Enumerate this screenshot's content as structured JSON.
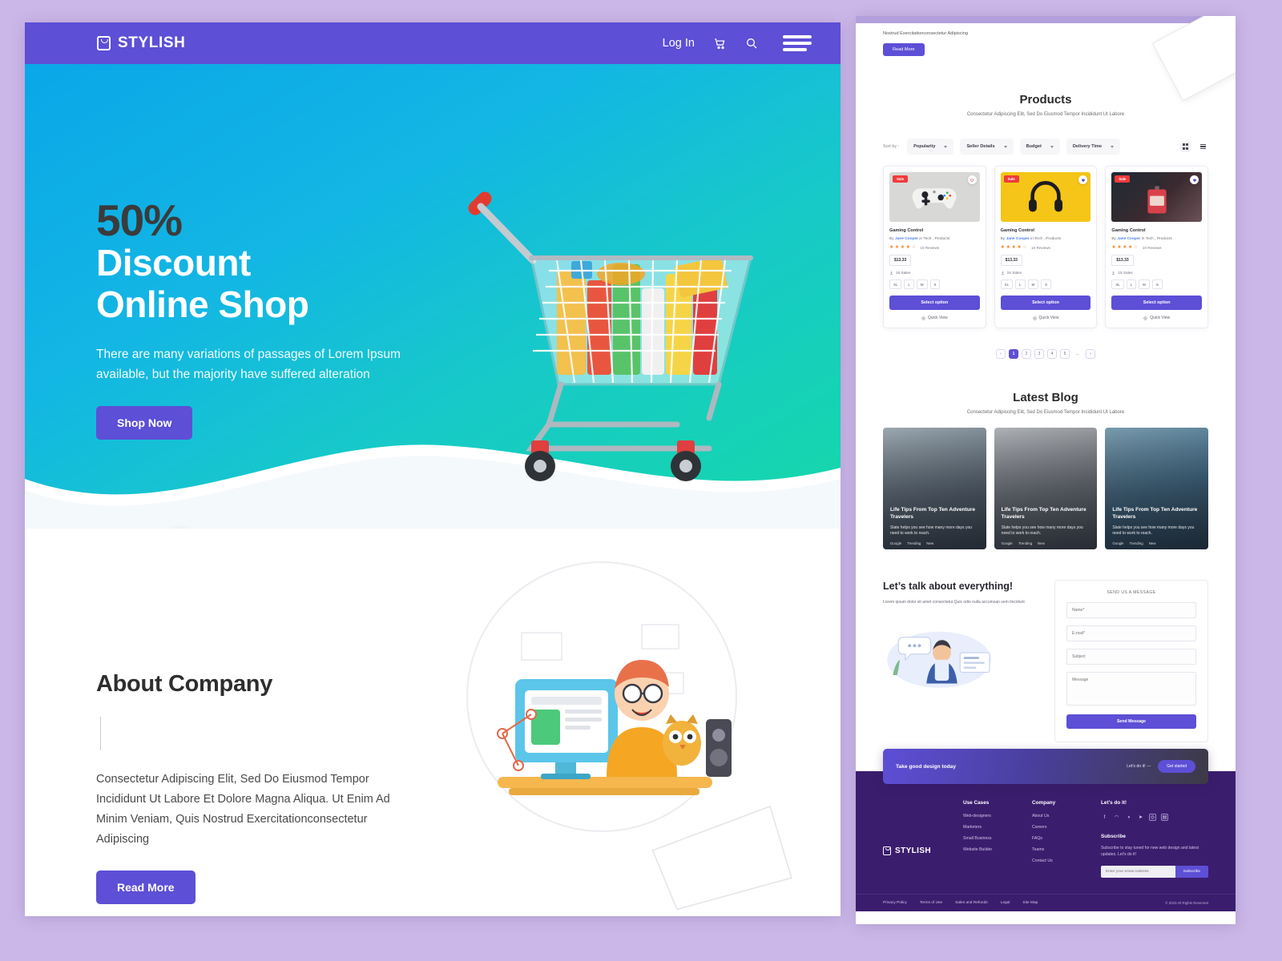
{
  "brand": {
    "name": "STYLISH",
    "logo_icon": "bag-icon"
  },
  "nav": {
    "login": "Log In",
    "cart_icon": "cart-icon",
    "search_icon": "search-icon",
    "menu_icon": "hamburger-menu-icon"
  },
  "hero": {
    "percent": "50%",
    "line2": "Discount",
    "line3": "Online Shop",
    "paragraph": "There are many variations of passages of Lorem Ipsum available, but the majority have suffered alteration",
    "cta": "Shop Now",
    "float_icon_1": "arrow-up-icon",
    "float_icon_2": "arrow-down-icon"
  },
  "about": {
    "title": "About Company",
    "paragraph": "Consectetur Adipiscing Elit, Sed Do Eiusmod Tempor Incididunt Ut Labore Et Dolore Magna Aliqua. Ut Enim Ad Minim Veniam, Quis Nostrud Exercitationconsectetur Adipiscing",
    "cta": "Read More"
  },
  "right": {
    "top_snippet": "Nostrud Exercitationconsectetur Adipiscing",
    "top_cta": "Read More",
    "products": {
      "title": "Products",
      "subtitle": "Consectetur Adipiscing Elit, Sed Do Eiusmod Tempor Incididunt Ut Labore",
      "sort_label": "Sort by :",
      "filters": [
        "Popularity",
        "Seller Details",
        "Budget",
        "Delivery Time"
      ],
      "view_grid_icon": "grid-view-icon",
      "view_list_icon": "list-view-icon",
      "items": [
        {
          "badge": "Sale",
          "name": "Gaming Control",
          "by_prefix": "By",
          "author": "Jane Cooper",
          "by_suffix": "in Tech , Products",
          "stars": 4,
          "reviews": "10 Reviews",
          "price": "$13.33",
          "sales": "15 Sales",
          "sizes": [
            "XL",
            "L",
            "M",
            "S"
          ],
          "cta": "Select option",
          "quick": "Quick View",
          "image_type": "gamepad",
          "bg": "#d8d8d6"
        },
        {
          "badge": "Sale",
          "name": "Gaming Control",
          "by_prefix": "By",
          "author": "Jane Cooper",
          "by_suffix": "in Tech , Products",
          "stars": 4,
          "reviews": "10 Reviews",
          "price": "$13.33",
          "sales": "15 Sales",
          "sizes": [
            "XL",
            "L",
            "M",
            "S"
          ],
          "cta": "Select option",
          "quick": "Quick View",
          "image_type": "headphones",
          "bg": "#f5c518"
        },
        {
          "badge": "Sale",
          "name": "Gaming Control",
          "by_prefix": "By",
          "author": "Jane Cooper",
          "by_suffix": "in Tech , Products",
          "stars": 4,
          "reviews": "10 Reviews",
          "price": "$13.33",
          "sales": "15 Sales",
          "sizes": [
            "XL",
            "L",
            "M",
            "S"
          ],
          "cta": "Select option",
          "quick": "Quick View",
          "image_type": "perfume",
          "bg": "#2b2b33"
        }
      ],
      "pagination": {
        "prev": "‹",
        "pages": [
          "1",
          "2",
          "3",
          "4",
          "5"
        ],
        "dots": "…",
        "next": "›",
        "active": "1"
      }
    },
    "blog": {
      "title": "Latest Blog",
      "subtitle": "Consectetur Adipiscing Elit, Sed Do Eiusmod Tempor Incididunt Ut Labore",
      "items": [
        {
          "title": "Life Tips From Top Ten Adventure Travelers",
          "desc": "Slate helps you see how many more days you need to work to reach.",
          "tags": [
            "Google",
            "Trending",
            "New"
          ],
          "bg": "#7d8a92"
        },
        {
          "title": "Life Tips From Top Ten Adventure Travelers",
          "desc": "Slate helps you see how many more days you need to work to reach.",
          "tags": [
            "Google",
            "Trending",
            "New"
          ],
          "bg": "#6b7076"
        },
        {
          "title": "Life Tips From Top Ten Adventure Travelers",
          "desc": "Slate helps you see how many more days you need to work to reach.",
          "tags": [
            "Google",
            "Trending",
            "New"
          ],
          "bg": "#46708a"
        }
      ]
    },
    "contact": {
      "title": "Let’s talk about everything!",
      "paragraph": "Lorem ipsum dolor sit amet consectetur.Quis odio nulla accumsan sem tincidunt",
      "form_title": "SEND US A MESSAGE",
      "fields": {
        "name": "Name*",
        "email": "E-mail*",
        "subject": "Subject",
        "message": "Message"
      },
      "submit": "Send Message"
    },
    "cta_banner": {
      "text": "Take good design today",
      "note": "Let's do it! —",
      "button": "Get started"
    },
    "footer": {
      "brand": "STYLISH",
      "columns": [
        {
          "heading": "Use Cases",
          "links": [
            "Web-designers",
            "Marketers",
            "Small Business",
            "Website Builder"
          ]
        },
        {
          "heading": "Company",
          "links": [
            "About Us",
            "Careers",
            "FAQs",
            "Teams",
            "Contact Us"
          ]
        }
      ],
      "social_heading": "Let's do it!",
      "social_icons": [
        "facebook-icon",
        "twitch-icon",
        "github-icon",
        "telegram-icon",
        "instagram-icon",
        "theater-icon"
      ],
      "subscribe_heading": "Subscribe",
      "subscribe_text": "Subscribe to stay tuned for new web design and latest updates. Let's do it!",
      "subscribe_placeholder": "Enter your email Address",
      "subscribe_button": "Subscribe",
      "bottom_links": [
        "Privacy Policy",
        "Terms of Use",
        "Sales and Refunds",
        "Legal",
        "Site Map"
      ],
      "copyright": "© 2023 All Rights Reserved"
    }
  },
  "colors": {
    "purple": "#5d4fd6",
    "deep_purple": "#3b1d6e",
    "page_bg": "#cbb8e8",
    "sale_red": "#ef3b3b",
    "star": "#f5821f"
  }
}
